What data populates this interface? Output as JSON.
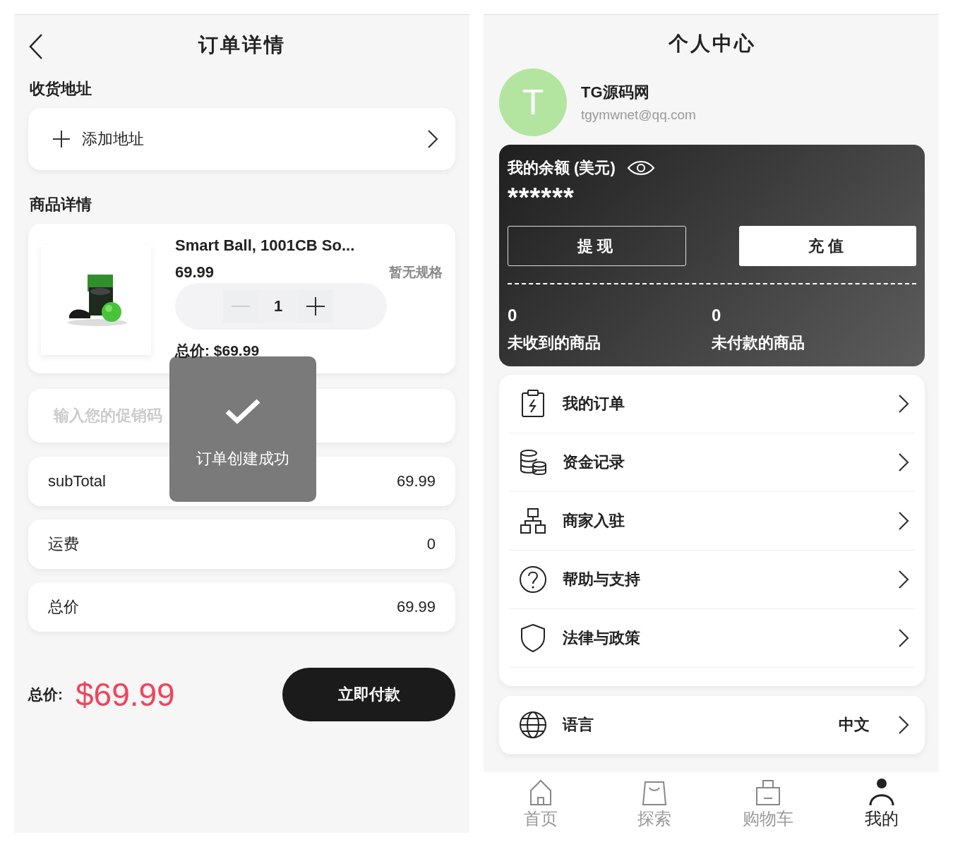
{
  "order": {
    "title": "订单详情",
    "address_label": "收货地址",
    "address_button": "添加地址",
    "goods_label": "商品详情",
    "product": {
      "name": "Smart Ball, 1001CB So...",
      "price": "69.99",
      "spec": "暂无规格",
      "quantity": "1",
      "decrease_disabled": true,
      "total": "总价: $69.99"
    },
    "promo": {
      "placeholder": "输入您的促销码"
    },
    "summary": [
      {
        "label": "subTotal",
        "value": "69.99"
      },
      {
        "label": "运费",
        "value": "0"
      },
      {
        "label": "总价",
        "value": "69.99"
      }
    ],
    "footer": {
      "total_label": "总价:",
      "total": "$69.99",
      "pay_button": "立即付款"
    },
    "toast": {
      "message": "订单创建成功"
    }
  },
  "profile": {
    "title": "个人中心",
    "avatar_letter": "T",
    "name": "TG源码网",
    "email": "tgymwnet@qq.com",
    "balance": {
      "label": "我的余额 (美元)",
      "amount": "******",
      "withdraw": "提现",
      "recharge": "充值",
      "stats": [
        {
          "value": "0",
          "label": "未收到的商品"
        },
        {
          "value": "0",
          "label": "未付款的商品"
        }
      ]
    },
    "menu": [
      {
        "label": "我的订单"
      },
      {
        "label": "资金记录"
      },
      {
        "label": "商家入驻"
      },
      {
        "label": "帮助与支持"
      },
      {
        "label": "法律与政策"
      }
    ],
    "settings": [
      {
        "label": "语言",
        "value": "中文"
      }
    ],
    "tabs": [
      {
        "label": "首页",
        "selected": false
      },
      {
        "label": "探索",
        "selected": false
      },
      {
        "label": "购物车",
        "selected": false
      },
      {
        "label": "我的",
        "selected": true
      }
    ]
  }
}
